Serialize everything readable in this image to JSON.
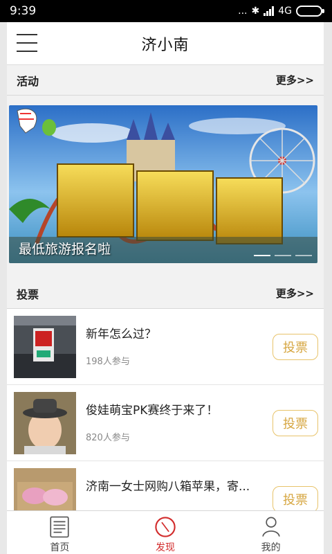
{
  "status_bar": {
    "time": "9:39",
    "indicators": "...",
    "network": "4G"
  },
  "header": {
    "title": "济小南",
    "menu_icon": "hamburger-menu-icon"
  },
  "activity_section": {
    "title": "活动",
    "more": "更多>>",
    "banner": {
      "caption": "最低旅游报名啦",
      "slide_count": 3,
      "active_slide": 1
    }
  },
  "vote_section": {
    "title": "投票",
    "more": "更多>>",
    "items": [
      {
        "title": "新年怎么过？",
        "count": "198人参与",
        "button": "投票"
      },
      {
        "title": "俊娃萌宝PK赛终于来了！",
        "count": "820人参与",
        "button": "投票"
      },
      {
        "title": "济南一女士网购八箱苹果，寄...",
        "count": "",
        "button": "投票"
      }
    ]
  },
  "bottom_nav": {
    "items": [
      {
        "label": "首页",
        "icon": "home-document-icon"
      },
      {
        "label": "发现",
        "icon": "compass-icon"
      },
      {
        "label": "我的",
        "icon": "user-icon"
      }
    ],
    "active": "发现",
    "active_color": "#d22c2c"
  },
  "colors": {
    "vote_button": "#d6a640",
    "vote_button_border": "#e8c36a"
  }
}
